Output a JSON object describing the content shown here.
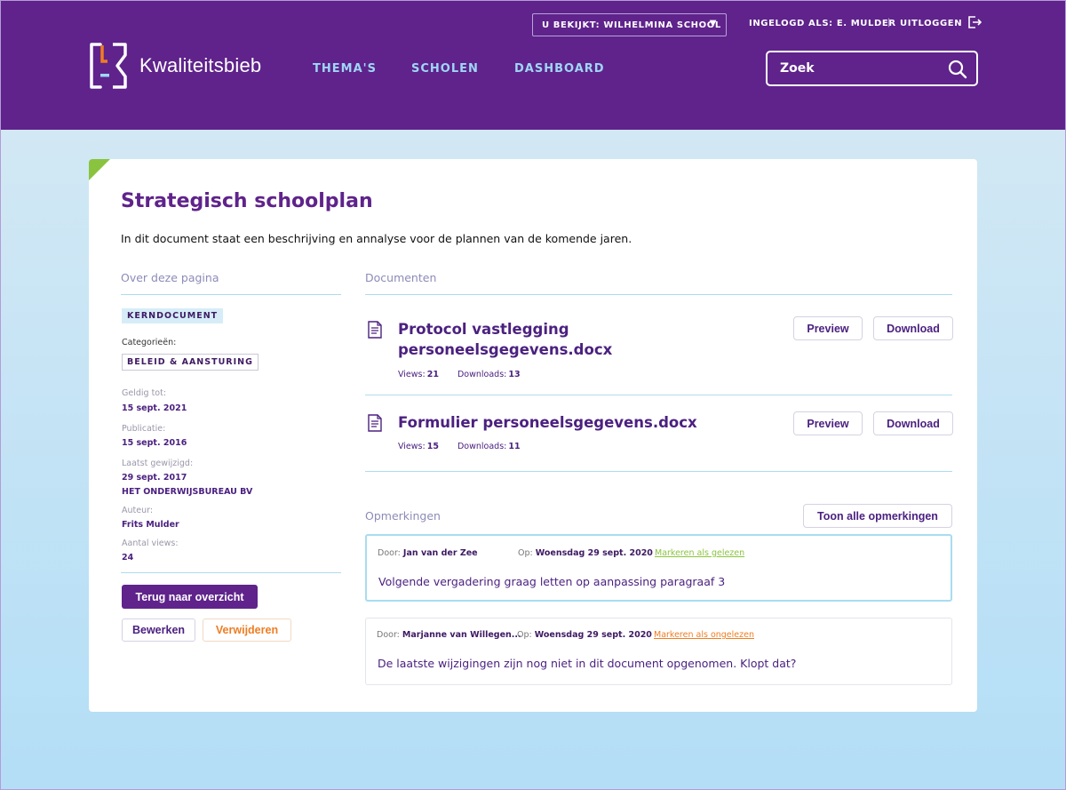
{
  "header": {
    "viewing_label": "U BEKIJKT: WILHELMINA SCHOOL",
    "logged_in": "INGELOGD ALS: E. MULDER",
    "separator": "|",
    "logout": "UITLOGGEN",
    "logo_text": "Kwaliteitsbieb",
    "nav": {
      "themes": "THEMA'S",
      "schools": "SCHOLEN",
      "dashboard": "DASHBOARD"
    },
    "search_placeholder": "Zoek"
  },
  "page": {
    "title": "Strategisch schoolplan",
    "description": "In dit document staat een beschrijving en annalyse voor de plannen van de komende jaren."
  },
  "about": {
    "heading": "Over deze pagina",
    "badge": "KERNDOCUMENT",
    "categories_label": "Categorieën:",
    "category": "BELEID & AANSTURING",
    "valid_until_label": "Geldig tot:",
    "valid_until": "15 sept. 2021",
    "published_label": "Publicatie:",
    "published": "15 sept. 2016",
    "modified_label": "Laatst gewijzigd:",
    "modified": "29 sept. 2017",
    "modified_by": "HET ONDERWIJSBUREAU BV",
    "author_label": "Auteur:",
    "author": "Frits Mulder",
    "views_label": "Aantal views:",
    "views": "24",
    "back_button": "Terug naar overzicht",
    "edit_button": "Bewerken",
    "delete_button": "Verwijderen"
  },
  "documents": {
    "heading": "Documenten",
    "preview_label": "Preview",
    "download_label": "Download",
    "views_label": "Views:",
    "downloads_label": "Downloads:",
    "items": [
      {
        "title": "Protocol vastlegging personeelsgegevens.docx",
        "views": "21",
        "downloads": "13"
      },
      {
        "title": "Formulier personeelsgegevens.docx",
        "views": "15",
        "downloads": "11"
      }
    ]
  },
  "remarks": {
    "heading": "Opmerkingen",
    "show_all": "Toon alle opmerkingen",
    "by_label": "Door:",
    "on_label": "Op:",
    "items": [
      {
        "author": "Jan van der Zee",
        "date": "Woensdag 29 sept. 2020",
        "mark": "Markeren als gelezen",
        "text": "Volgende vergadering graag letten op aanpassing paragraaf 3"
      },
      {
        "author": "Marjanne van Willegen...",
        "date": "Woensdag 29 sept. 2020",
        "mark": "Markeren als ongelezen",
        "text": "De laatste wijzigingen zijn nog niet in dit document opgenomen. Klopt dat?"
      }
    ]
  },
  "colors": {
    "brand_purple": "#5f238b",
    "accent_green": "#8ac43f",
    "accent_orange": "#ef7d22",
    "nav_blue": "#9fd6f5"
  }
}
